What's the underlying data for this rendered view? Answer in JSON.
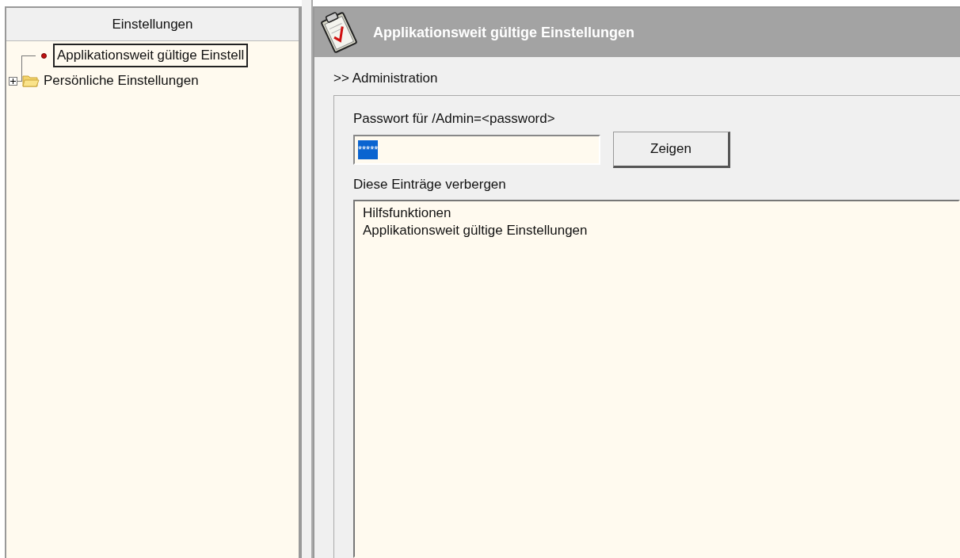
{
  "sidebar": {
    "header": "Einstellungen",
    "items": [
      {
        "label": "Applikationsweit gültige Einstell",
        "kind": "leaf",
        "selected": true
      },
      {
        "label": "Persönliche Einstellungen",
        "kind": "folder",
        "selected": false,
        "expanded": false
      }
    ]
  },
  "panel": {
    "title": "Applikationsweit gültige Einstellungen",
    "breadcrumb": ">> Administration",
    "password": {
      "label": "Passwort für /Admin=<password>",
      "value": "*****",
      "button": "Zeigen"
    },
    "hidden": {
      "label": "Diese Einträge verbergen",
      "items": [
        "Hilfsfunktionen",
        "Applikationsweit gültige Einstellungen"
      ]
    }
  }
}
